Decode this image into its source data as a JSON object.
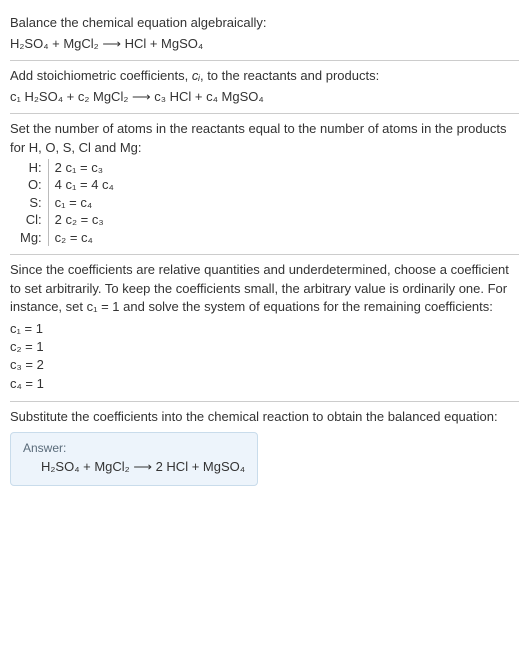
{
  "section1": {
    "title": "Balance the chemical equation algebraically:",
    "equation": "H₂SO₄ + MgCl₂ ⟶ HCl + MgSO₄"
  },
  "section2": {
    "intro_a": "Add stoichiometric coefficients, ",
    "intro_ci": "cᵢ",
    "intro_b": ", to the reactants and products:",
    "equation": "c₁ H₂SO₄ + c₂ MgCl₂ ⟶ c₃ HCl + c₄ MgSO₄"
  },
  "section3": {
    "intro": "Set the number of atoms in the reactants equal to the number of atoms in the products for H, O, S, Cl and Mg:",
    "rows": [
      {
        "el": "H:",
        "eq": "2 c₁ = c₃"
      },
      {
        "el": "O:",
        "eq": "4 c₁ = 4 c₄"
      },
      {
        "el": "S:",
        "eq": "c₁ = c₄"
      },
      {
        "el": "Cl:",
        "eq": "2 c₂ = c₃"
      },
      {
        "el": "Mg:",
        "eq": "c₂ = c₄"
      }
    ]
  },
  "section4": {
    "intro": "Since the coefficients are relative quantities and underdetermined, choose a coefficient to set arbitrarily. To keep the coefficients small, the arbitrary value is ordinarily one. For instance, set c₁ = 1 and solve the system of equations for the remaining coefficients:",
    "solved": [
      "c₁ = 1",
      "c₂ = 1",
      "c₃ = 2",
      "c₄ = 1"
    ]
  },
  "section5": {
    "intro": "Substitute the coefficients into the chemical reaction to obtain the balanced equation:",
    "answer_label": "Answer:",
    "answer_eq": "H₂SO₄ + MgCl₂ ⟶ 2 HCl + MgSO₄"
  }
}
